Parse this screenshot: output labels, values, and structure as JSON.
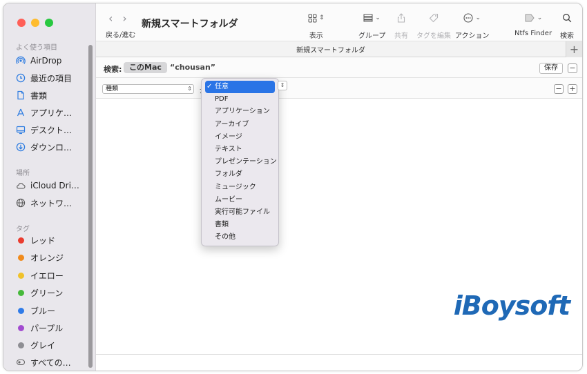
{
  "sidebar": {
    "favorites_title": "よく使う項目",
    "favorites": [
      {
        "label": "AirDrop",
        "icon": "airdrop-icon"
      },
      {
        "label": "最近の項目",
        "icon": "clock-icon"
      },
      {
        "label": "書類",
        "icon": "document-icon"
      },
      {
        "label": "アプリケ…",
        "icon": "applications-icon"
      },
      {
        "label": "デスクト…",
        "icon": "desktop-icon"
      },
      {
        "label": "ダウンロ…",
        "icon": "download-icon"
      }
    ],
    "locations_title": "場所",
    "locations": [
      {
        "label": "iCloud Dri…",
        "icon": "cloud-icon"
      },
      {
        "label": "ネットワ…",
        "icon": "network-icon"
      }
    ],
    "tags_title": "タグ",
    "tags": [
      {
        "label": "レッド",
        "color": "#ea3c2f"
      },
      {
        "label": "オレンジ",
        "color": "#f08a1b"
      },
      {
        "label": "イエロー",
        "color": "#f0c22a"
      },
      {
        "label": "グリーン",
        "color": "#46b93a"
      },
      {
        "label": "ブルー",
        "color": "#2f7be8"
      },
      {
        "label": "パープル",
        "color": "#a24bd0"
      },
      {
        "label": "グレイ",
        "color": "#8e8e93"
      },
      {
        "label": "すべての…",
        "color": ""
      }
    ]
  },
  "toolbar": {
    "back_forward_label": "戻る/進む",
    "title": "新規スマートフォルダ",
    "buttons": [
      {
        "label": "表示",
        "icon": "grid-view-icon"
      },
      {
        "label": "グループ",
        "icon": "group-icon"
      },
      {
        "label": "共有",
        "icon": "share-icon"
      },
      {
        "label": "タグを編集",
        "icon": "tag-icon"
      },
      {
        "label": "アクション",
        "icon": "action-icon"
      },
      {
        "label": "Ntfs Finder",
        "icon": "ntfs-finder-icon"
      },
      {
        "label": "検索",
        "icon": "search-icon"
      }
    ]
  },
  "tabbar": {
    "title": "新規スマートフォルダ",
    "add_label": "+"
  },
  "search": {
    "label": "検索:",
    "scope_this_mac": "このMac",
    "scope_folder": "“chousan”",
    "save_label": "保存",
    "remove_label": "−"
  },
  "criteria": {
    "attribute": "種類",
    "operator_fragment": "が",
    "remove_label": "−",
    "add_label": "+"
  },
  "kind_menu": {
    "selected": "任意",
    "items": [
      "任意",
      "PDF",
      "アプリケーション",
      "アーカイブ",
      "イメージ",
      "テキスト",
      "プレゼンテーション",
      "フォルダ",
      "ミュージック",
      "ムービー",
      "実行可能ファイル",
      "書類",
      "その他"
    ]
  },
  "watermark": "iBoysoft",
  "colors": {
    "accent": "#2a74e6",
    "sidebar_bg": "#e9e7ec",
    "close": "#ff5f57",
    "minimize": "#febc2e",
    "zoom": "#28c840",
    "watermark": "#1f69b6"
  }
}
